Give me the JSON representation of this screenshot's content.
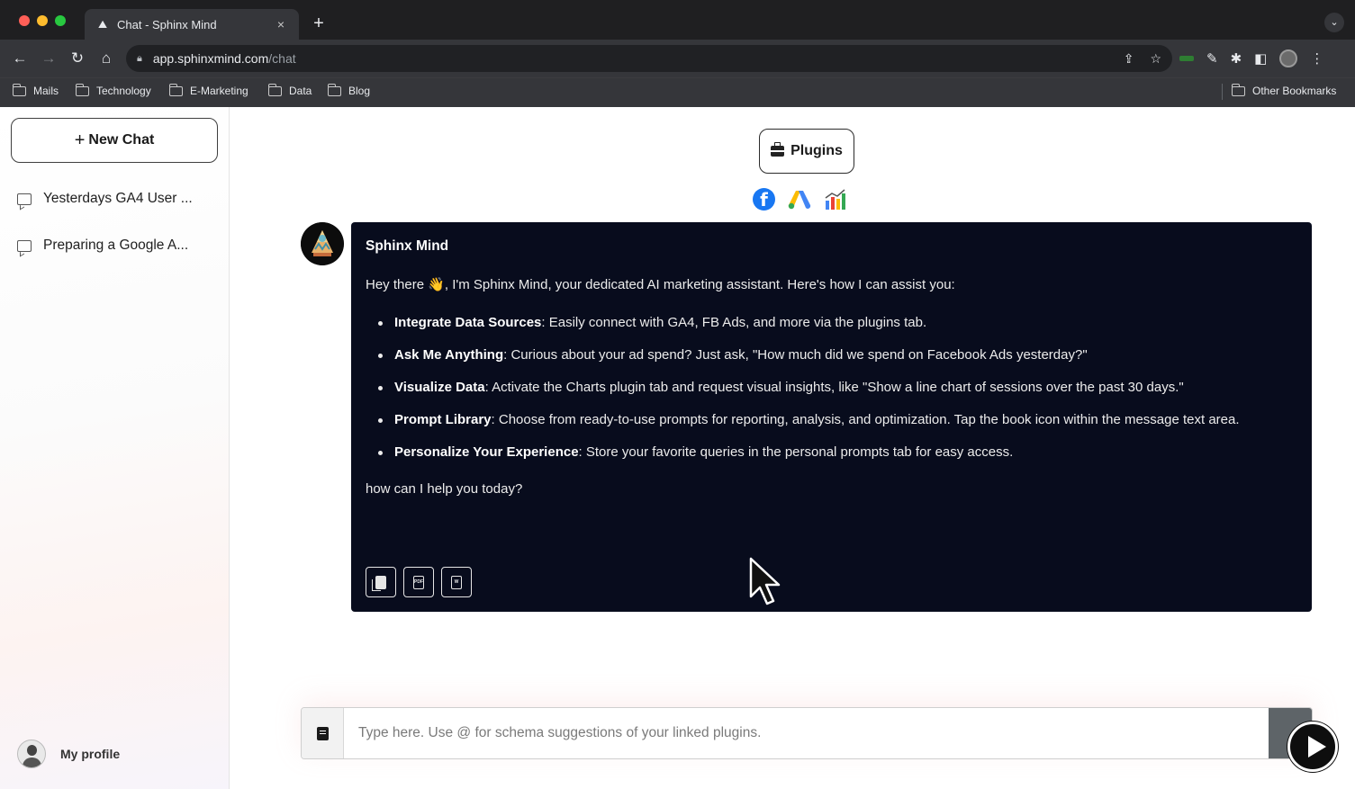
{
  "browser": {
    "tab_title": "Chat - Sphinx Mind",
    "tab_close": "×",
    "new_tab": "+",
    "url_host": "app.sphinxmind.com",
    "url_path": "/chat",
    "bookmarks": [
      "Mails",
      "Technology",
      "E-Marketing",
      "Data",
      "Blog"
    ],
    "other_bookmarks": "Other Bookmarks"
  },
  "sidebar": {
    "new_chat_label": "New Chat",
    "conversations": [
      "Yesterdays GA4 User ...",
      "Preparing a Google A..."
    ],
    "profile_label": "My profile"
  },
  "main": {
    "plugins_label": "Plugins",
    "plugin_icons": [
      "facebook-icon",
      "google-ads-icon",
      "charts-icon"
    ],
    "message": {
      "sender": "Sphinx Mind",
      "intro": "Hey there 👋, I'm Sphinx Mind, your dedicated AI marketing assistant. Here's how I can assist you:",
      "items": [
        {
          "title": "Integrate Data Sources",
          "text": ": Easily connect with GA4, FB Ads, and more via the plugins tab."
        },
        {
          "title": "Ask Me Anything",
          "text": ": Curious about your ad spend? Just ask, \"How much did we spend on Facebook Ads yesterday?\""
        },
        {
          "title": "Visualize Data",
          "text": ": Activate the Charts plugin tab and request visual insights, like \"Show a line chart of sessions over the past 30 days.\""
        },
        {
          "title": "Prompt Library",
          "text": ": Choose from ready-to-use prompts for reporting, analysis, and optimization. Tap the book icon within the message text area."
        },
        {
          "title": "Personalize Your Experience",
          "text": ": Store your favorite queries in the personal prompts tab for easy access."
        }
      ],
      "outro": "how can I help you today?",
      "pdf_label": "PDF",
      "word_label": "W"
    },
    "input_placeholder": "Type here. Use @ for schema suggestions of your linked plugins."
  },
  "colors": {
    "bubble_bg": "#080c1d",
    "facebook": "#1877f2",
    "traffic_red": "#ff5f57",
    "traffic_yellow": "#febc2e",
    "traffic_green": "#28c840"
  }
}
